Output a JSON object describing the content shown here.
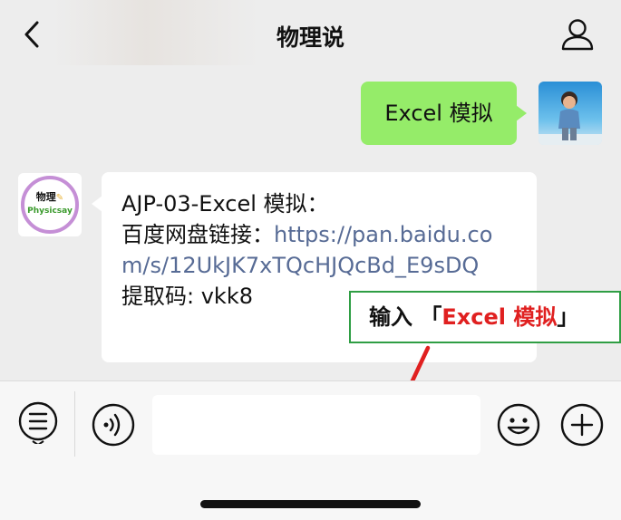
{
  "header": {
    "title": "物理说",
    "back_icon": "chevron-left-icon",
    "profile_icon": "person-icon"
  },
  "messages": [
    {
      "direction": "outgoing",
      "text": "Excel 模拟",
      "bubble_color": "#95ec69"
    },
    {
      "direction": "incoming",
      "sender_logo": {
        "top_text": "物理",
        "bottom_text": "Physicsay",
        "ring_color": "#c58fd6"
      },
      "line1": "AJP-03-Excel 模拟：",
      "line2_prefix": "百度网盘链接：",
      "link": "https://pan.baidu.com/s/12UkJK7xTQcHJQcBd_E9sDQ",
      "line3": "提取码: vkk8",
      "link_color": "#576b95"
    }
  ],
  "annotation": {
    "prefix": "输入 「",
    "highlight": "Excel 模拟",
    "suffix": "」",
    "border_color": "#2f9e44",
    "highlight_color": "#e02020"
  },
  "input_bar": {
    "menu_icon": "list-menu-icon",
    "voice_icon": "voice-icon",
    "emoji_icon": "emoji-icon",
    "plus_icon": "plus-icon",
    "text_value": ""
  }
}
